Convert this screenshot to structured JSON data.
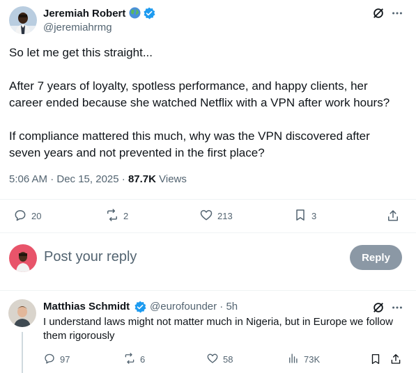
{
  "tweet": {
    "author_name": "Jeremiah Robert",
    "author_handle": "@jeremiahrmg",
    "lines": [
      "So let me get this straight...",
      "After 7 years of loyalty, spotless performance, and happy clients, her",
      "career ended because she watched Netflix with a VPN after work hours?",
      "If compliance mattered this much, why was the VPN discovered after",
      "seven years and not prevented in the first place?"
    ],
    "timestamp": "5:06 AM · Dec 15, 2025 · ",
    "views_count": "87.7K",
    "views_label": " Views",
    "stats": {
      "replies": "20",
      "reposts": "2",
      "likes": "213",
      "bookmarks": "3"
    }
  },
  "composer": {
    "placeholder": "Post your reply",
    "button_label": "Reply"
  },
  "reply": {
    "author_name": "Matthias Schmidt",
    "author_handle": "@eurofounder",
    "time": " · 5h",
    "lines": [
      "I understand laws might not matter much in Nigeria, but in Europe we follow",
      "them rigorously"
    ],
    "stats": {
      "replies": "97",
      "reposts": "6",
      "likes": "58",
      "views": "73K"
    }
  },
  "colors": {
    "verified": "#1d9bf0",
    "muted": "#536471",
    "text": "#0f1419",
    "reply_button": "#8b98a5"
  },
  "icons": {
    "globe": "globe-emoji-icon",
    "verified": "verified-badge-icon",
    "grok": "grok-icon",
    "more": "more-icon",
    "reply": "reply-icon",
    "repost": "repost-icon",
    "like": "heart-icon",
    "bookmark": "bookmark-icon",
    "share": "share-icon",
    "views": "views-icon"
  }
}
